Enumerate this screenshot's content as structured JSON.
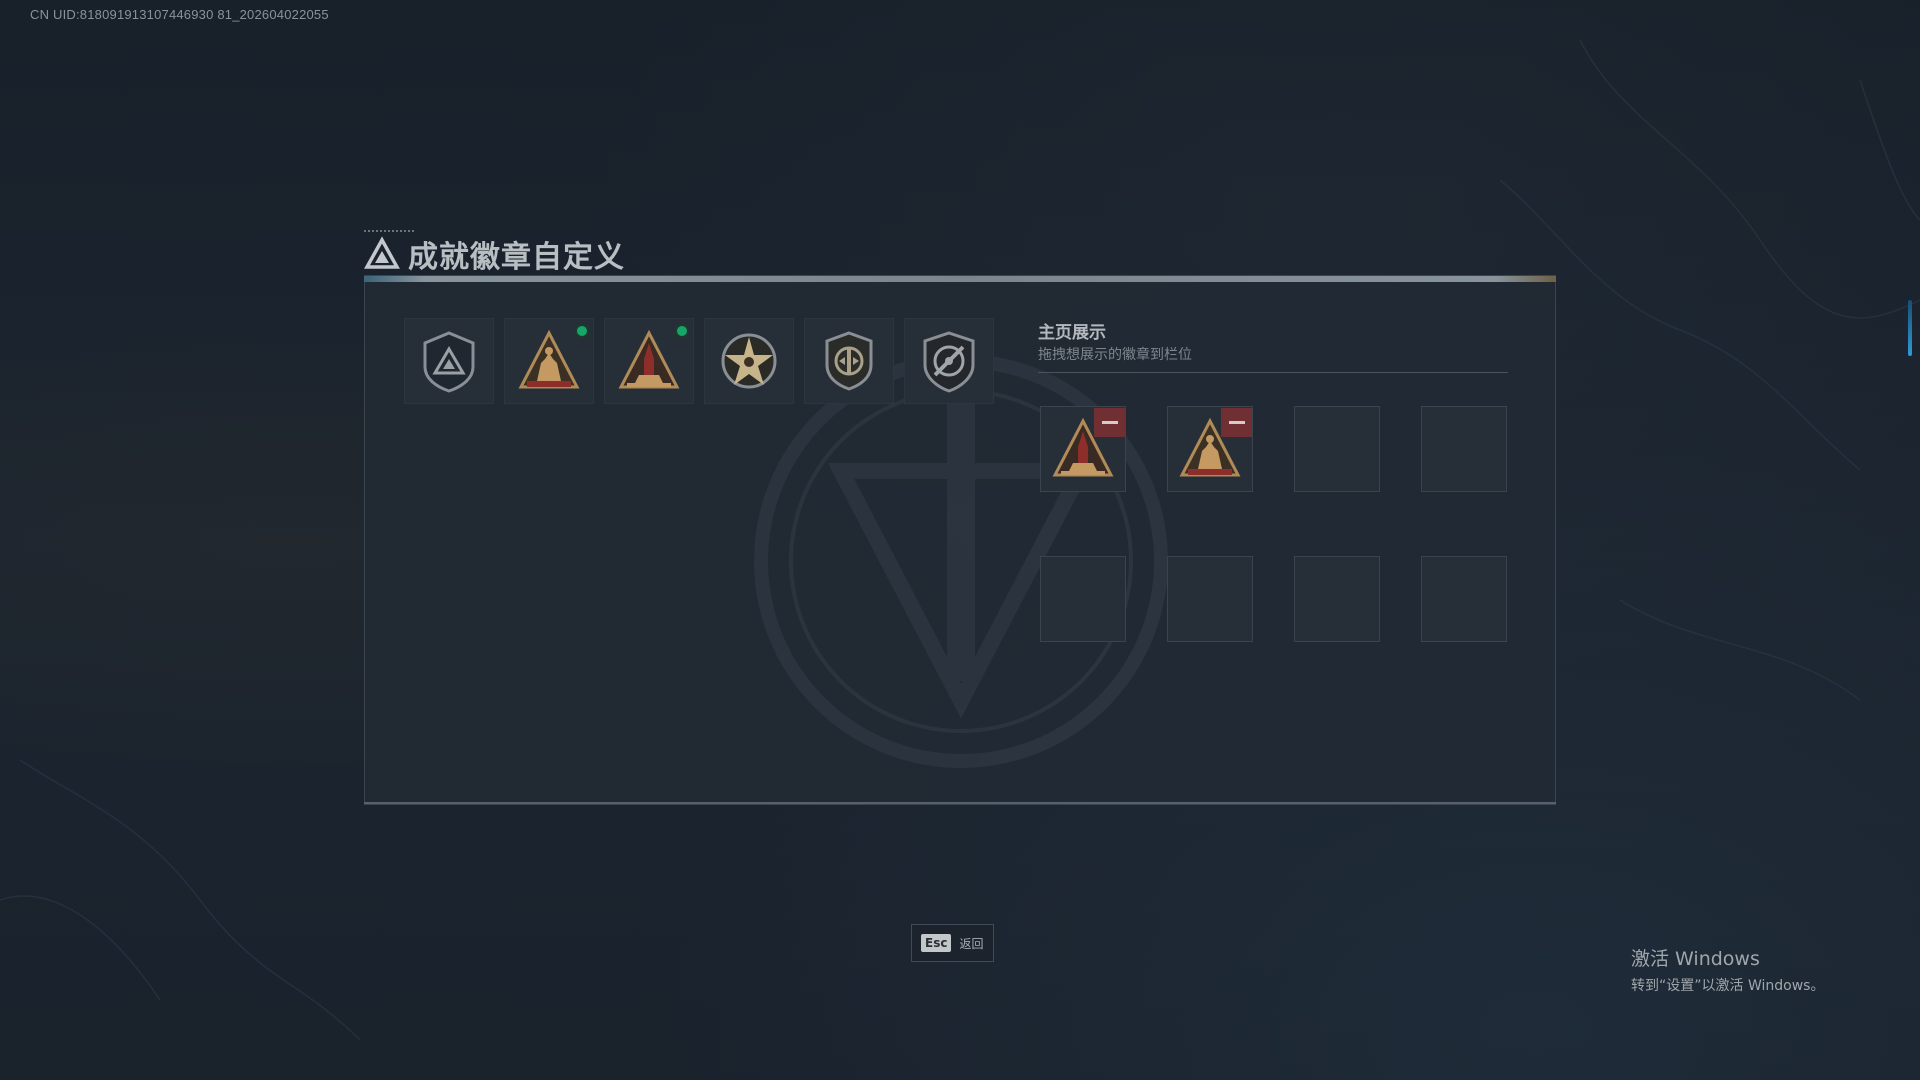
{
  "uid_text": "CN UID:818091913107446930 81_202604022055",
  "page": {
    "title": "成就徽章自定义"
  },
  "badges": [
    {
      "icon": "shield-triangle-badge",
      "new": false
    },
    {
      "icon": "soldiers-triangle-badge",
      "new": true
    },
    {
      "icon": "rocket-triangle-badge",
      "new": true
    },
    {
      "icon": "star-wheel-badge",
      "new": false
    },
    {
      "icon": "emblem-shield-badge",
      "new": false
    },
    {
      "icon": "target-shield-badge",
      "new": false
    }
  ],
  "showcase": {
    "title": "主页展示",
    "subtitle": "拖拽想展示的徽章到栏位",
    "slots": [
      {
        "icon": "rocket-triangle-badge",
        "filled": true
      },
      {
        "icon": "soldiers-triangle-badge",
        "filled": true
      },
      {
        "filled": false
      },
      {
        "filled": false
      },
      {
        "filled": false
      },
      {
        "filled": false
      },
      {
        "filled": false
      },
      {
        "filled": false
      }
    ]
  },
  "footer": {
    "esc_key": "Esc",
    "back_label": "返回"
  },
  "windows_activation": {
    "title": "激活 Windows",
    "subtitle": "转到“设置”以激活 Windows。"
  },
  "colors": {
    "new_dot": "#18a56a",
    "remove": "#6f2f33",
    "badge_gold": "#b08a57"
  }
}
